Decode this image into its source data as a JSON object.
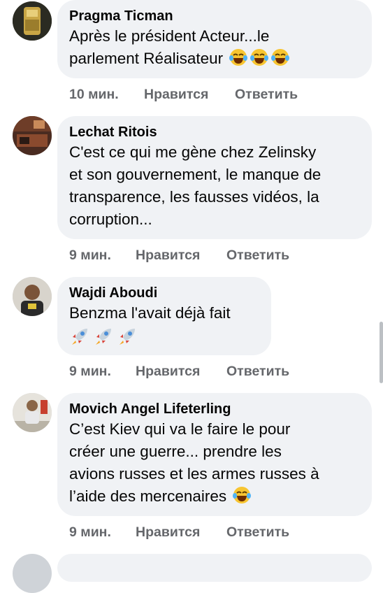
{
  "comments": [
    {
      "author": "Pragma Ticman",
      "lines": [
        "Après le président Acteur...le",
        "parlement Réalisateur"
      ],
      "emojis": [
        "laughing-tears",
        "laughing-tears",
        "laughing-tears"
      ],
      "time": "10 мин.",
      "like_label": "Нравится",
      "reply_label": "Ответить"
    },
    {
      "author": "Lechat Ritois",
      "lines": [
        "C'est ce qui me gène chez Zelinsky",
        "et son gouvernement, le manque de",
        "transparence, les fausses vidéos, la",
        "corruption..."
      ],
      "time": "9 мин.",
      "like_label": "Нравится",
      "reply_label": "Ответить"
    },
    {
      "author": "Wajdi Aboudi",
      "lines": [
        "Benzma l'avait déjà fait"
      ],
      "emojis": [
        "rocket",
        "rocket",
        "rocket"
      ],
      "time": "9 мин.",
      "like_label": "Нравится",
      "reply_label": "Ответить"
    },
    {
      "author": "Movich Angel Lifeterling",
      "lines": [
        "C’est Kiev qui va le faire le pour",
        "créer une guerre... prendre les",
        "avions russes et les armes russes à",
        "l’aide des mercenaires"
      ],
      "emojis": [
        "laughing-tears"
      ],
      "time": "9 мин.",
      "like_label": "Нравится",
      "reply_label": "Ответить"
    }
  ],
  "colors": {
    "bubble": "#f0f2f5",
    "action_text": "#65676b",
    "text": "#050505"
  }
}
